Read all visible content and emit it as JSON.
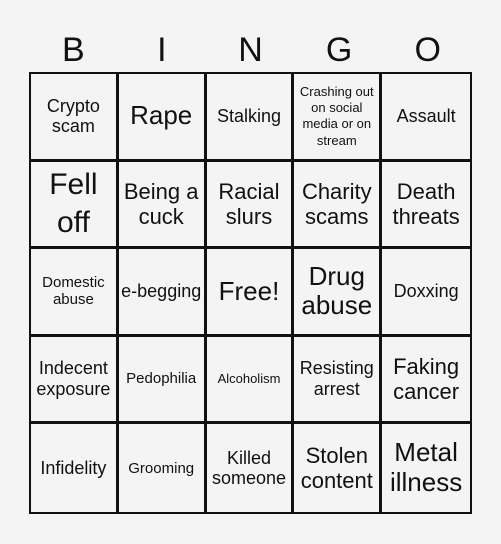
{
  "header": {
    "letters": [
      "B",
      "I",
      "N",
      "G",
      "O"
    ]
  },
  "board": {
    "cells": [
      [
        "Crypto scam",
        "Rape",
        "Stalking",
        "Crashing out on social media or on stream",
        "Assault"
      ],
      [
        "Fell off",
        "Being a cuck",
        "Racial slurs",
        "Charity scams",
        "Death threats"
      ],
      [
        "Domestic abuse",
        "e-begging",
        "Free!",
        "Drug abuse",
        "Doxxing"
      ],
      [
        "Indecent exposure",
        "Pedophilia",
        "Alcoholism",
        "Resisting arrest",
        "Faking cancer"
      ],
      [
        "Infidelity",
        "Grooming",
        "Killed someone",
        "Stolen content",
        "Metal illness"
      ]
    ]
  }
}
